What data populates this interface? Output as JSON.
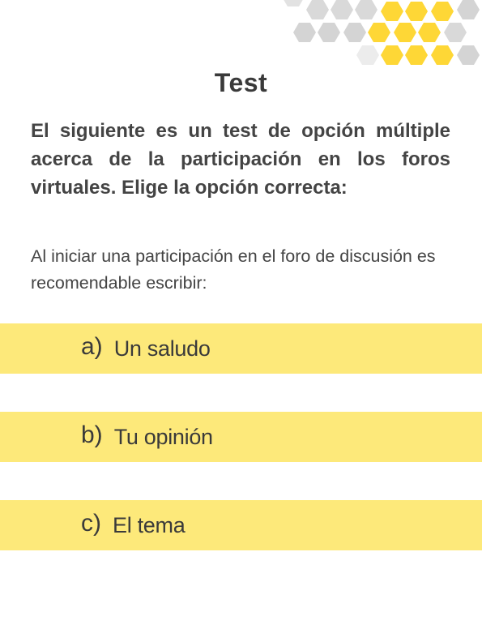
{
  "title": "Test",
  "intro": "El siguiente es un test de opción múltiple acerca de la participación en los foros virtuales. Elige la opción correcta:",
  "question": "Al iniciar una participación en el foro  de discusión es recomendable escribir:",
  "options": [
    {
      "letter": "a)",
      "text": "Un saludo"
    },
    {
      "letter": "b)",
      "text": "Tu opinión"
    },
    {
      "letter": "c)",
      "text": "El tema"
    }
  ],
  "colors": {
    "accent_yellow": "#fed736",
    "option_bg": "#fde97a",
    "hex_gray": "#d4d4d4",
    "text": "#3a3a3a"
  },
  "decoration": {
    "icon": "honeycomb-pattern"
  }
}
